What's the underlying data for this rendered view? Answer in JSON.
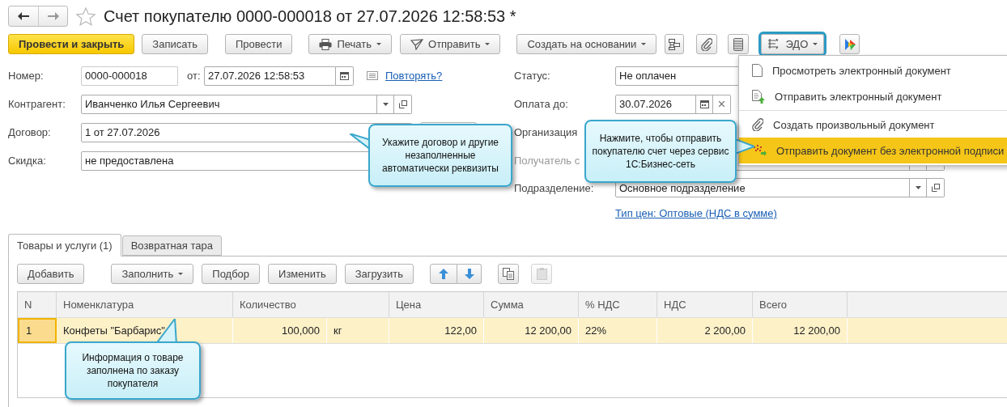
{
  "window": {
    "title": "Счет покупателю 0000-000018 от 27.07.2026 12:58:53 *"
  },
  "toolbar": {
    "buttons": [
      {
        "kind": "primary",
        "label": "Провести и закрыть"
      },
      {
        "kind": "plain",
        "label": "Записать"
      },
      {
        "kind": "plain",
        "label": "Провести"
      },
      {
        "kind": "print",
        "label": "Печать"
      },
      {
        "kind": "send",
        "label": "Отправить"
      },
      {
        "kind": "dropdown",
        "label": "Создать на основании"
      }
    ],
    "edo": {
      "label": "ЭДО",
      "open": true
    }
  },
  "edo_menu": [
    {
      "kind": "view",
      "label": "Просмотреть электронный документ",
      "selected": false,
      "divider_before": false
    },
    {
      "kind": "send",
      "label": "Отправить электронный документ",
      "selected": false,
      "divider_before": false
    },
    {
      "kind": "attach",
      "label": "Создать произвольный документ",
      "selected": false,
      "divider_before": true
    },
    {
      "kind": "nosign",
      "label": "Отправить документ без электронной подписи",
      "selected": true,
      "divider_before": false
    }
  ],
  "form": {
    "number": {
      "label": "Номер:",
      "value": "0000-000018",
      "from_label": "от:",
      "date": "27.07.2026 12:58:53",
      "link": "Повторять?"
    },
    "counterparty": {
      "label": "Контрагент:",
      "value": "Иванченко Илья Сергеевич"
    },
    "contract": {
      "label": "Договор:",
      "value": "1 от 27.07.2026"
    },
    "discount": {
      "label": "Скидка:",
      "value": "не предоставлена"
    },
    "status": {
      "label": "Статус:",
      "value": "Не оплачен"
    },
    "pay_until": {
      "label": "Оплата до:",
      "value": "30.07.2026"
    },
    "organization": {
      "label": "Организация"
    },
    "recipient": {
      "label": "Получатель с"
    },
    "department": {
      "label": "Подразделение:",
      "value": "Основное подразделение"
    },
    "price_type_link": "Тип цен: Оптовые (НДС в сумме)"
  },
  "tabs": [
    {
      "label": "Товары и услуги (1)",
      "selected": true
    },
    {
      "label": "Возвратная тара",
      "selected": false
    }
  ],
  "table_toolbar": [
    {
      "kind": "plain",
      "label": "Добавить"
    },
    {
      "kind": "dropdown",
      "label": "Заполнить"
    },
    {
      "kind": "plain",
      "label": "Подбор"
    },
    {
      "kind": "plain",
      "label": "Изменить"
    },
    {
      "kind": "plain",
      "label": "Загрузить"
    }
  ],
  "table": {
    "columns": [
      "N",
      "Номенклатура",
      "Количество",
      "",
      "Цена",
      "Сумма",
      "% НДС",
      "НДС",
      "Всего"
    ],
    "rows": [
      {
        "selected": true,
        "cells": [
          "1",
          "Конфеты \"Барбарис\"",
          "100,000",
          "кг",
          "122,00",
          "12 200,00",
          "22%",
          "2 200,00",
          "12 200,00"
        ]
      }
    ]
  },
  "callouts": [
    "Укажите договор и другие незаполненные автоматически реквизиты",
    "Нажмите, чтобы отправить покупателю счет через сервис 1С:Бизнес-сеть",
    "Информация о товаре заполнена по заказу покупателя"
  ]
}
